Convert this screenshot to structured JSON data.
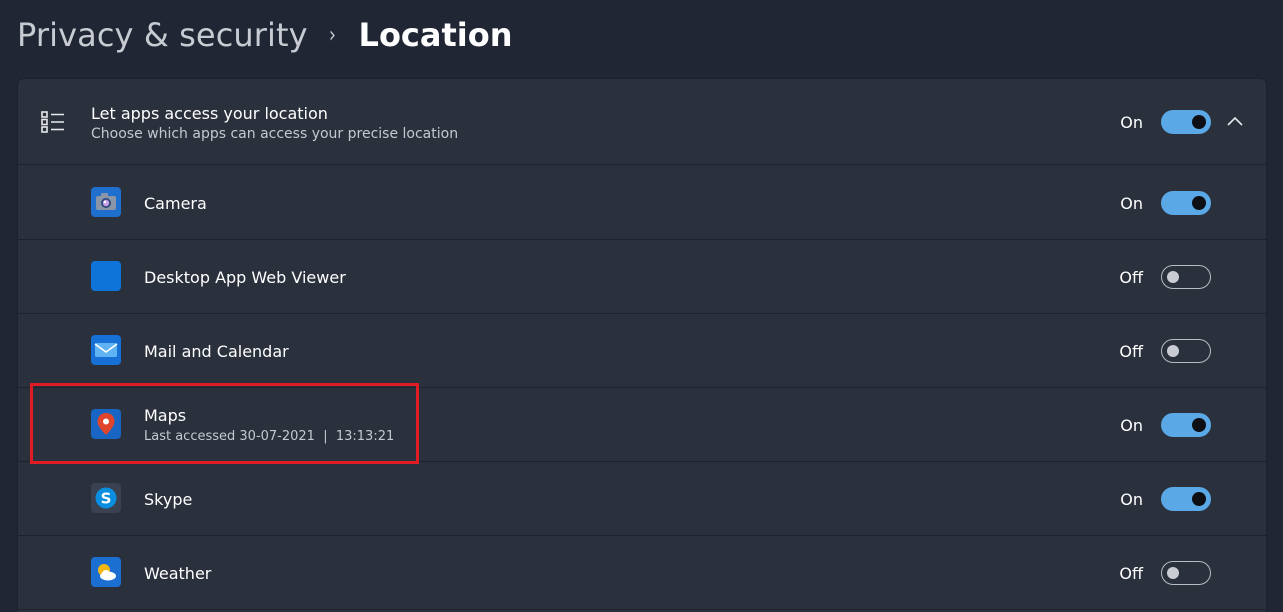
{
  "breadcrumb": {
    "parent": "Privacy & security",
    "separator": "›",
    "current": "Location"
  },
  "header": {
    "title": "Let apps access your location",
    "subtitle": "Choose which apps can access your precise location",
    "state_label": "On",
    "toggle_on": true,
    "icon": "list-settings-icon",
    "expand_icon": "chevron-up-icon"
  },
  "apps": [
    {
      "name": "Camera",
      "sub": "",
      "state_label": "On",
      "toggle_on": true,
      "icon": "camera-icon"
    },
    {
      "name": "Desktop App Web Viewer",
      "sub": "",
      "state_label": "Off",
      "toggle_on": false,
      "icon": "web-viewer-icon"
    },
    {
      "name": "Mail and Calendar",
      "sub": "",
      "state_label": "Off",
      "toggle_on": false,
      "icon": "mail-icon"
    },
    {
      "name": "Maps",
      "sub": "Last accessed 30-07-2021  |  13:13:21",
      "state_label": "On",
      "toggle_on": true,
      "icon": "maps-icon"
    },
    {
      "name": "Skype",
      "sub": "",
      "state_label": "On",
      "toggle_on": true,
      "icon": "skype-icon"
    },
    {
      "name": "Weather",
      "sub": "",
      "state_label": "Off",
      "toggle_on": false,
      "icon": "weather-icon"
    }
  ],
  "colors": {
    "accent": "#5aa9e6",
    "background": "#202633",
    "card": "#2a303c",
    "highlight": "#e01b24"
  }
}
